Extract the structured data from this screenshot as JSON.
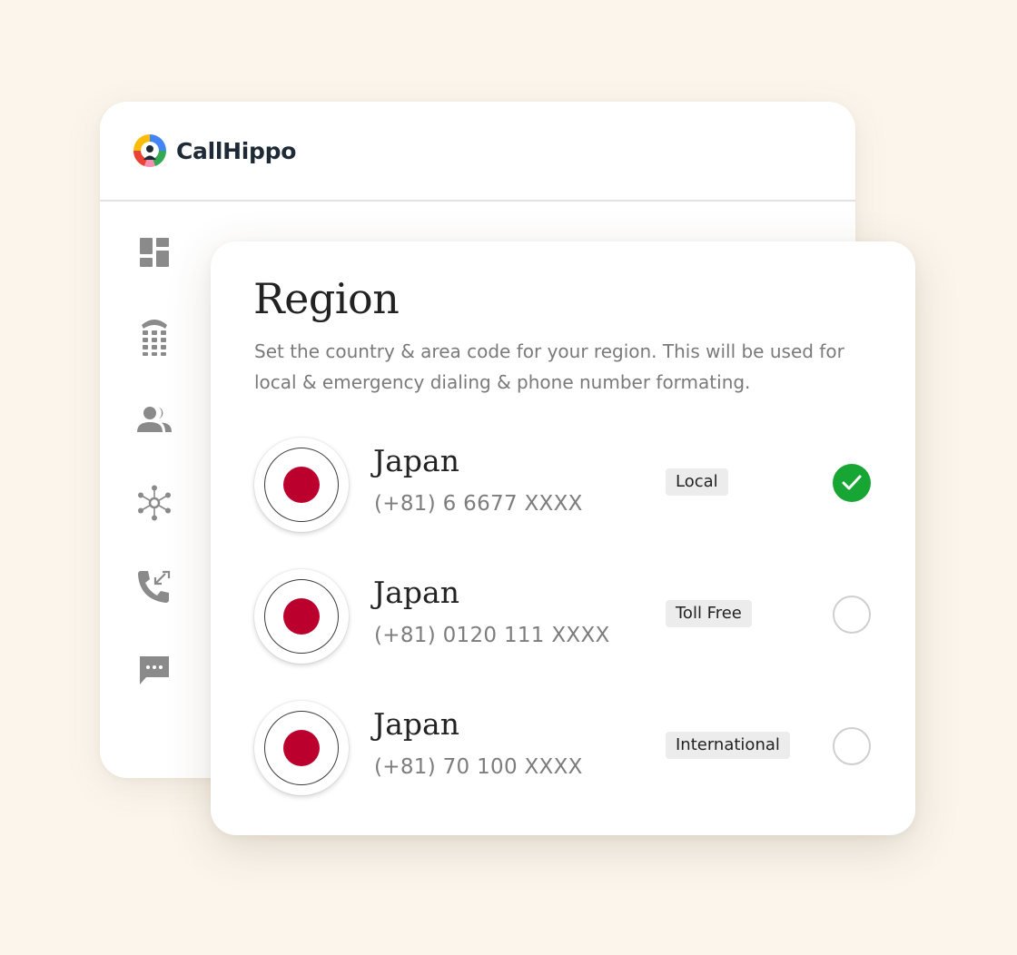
{
  "app": {
    "logo_text": "CallHippo",
    "sidebar": [
      {
        "name": "dashboard-icon"
      },
      {
        "name": "dialpad-phone-icon"
      },
      {
        "name": "users-icon"
      },
      {
        "name": "integrations-icon"
      },
      {
        "name": "call-logs-icon"
      },
      {
        "name": "messages-icon"
      }
    ]
  },
  "region": {
    "title": "Region",
    "description": "Set the country & area code for your region. This will be used for local & emergency dialing & phone number formating.",
    "options": [
      {
        "country": "Japan",
        "number": "(+81) 6 6677 XXXX",
        "type": "Local",
        "selected": true
      },
      {
        "country": "Japan",
        "number": "(+81) 0120 111 XXXX",
        "type": "Toll Free",
        "selected": false
      },
      {
        "country": "Japan",
        "number": "(+81) 70 100 XXXX",
        "type": "International",
        "selected": false
      }
    ]
  },
  "colors": {
    "background": "#fbf5ec",
    "selected": "#17a534",
    "flag_red": "#bc002d",
    "icon_gray": "#8a8a8a"
  }
}
